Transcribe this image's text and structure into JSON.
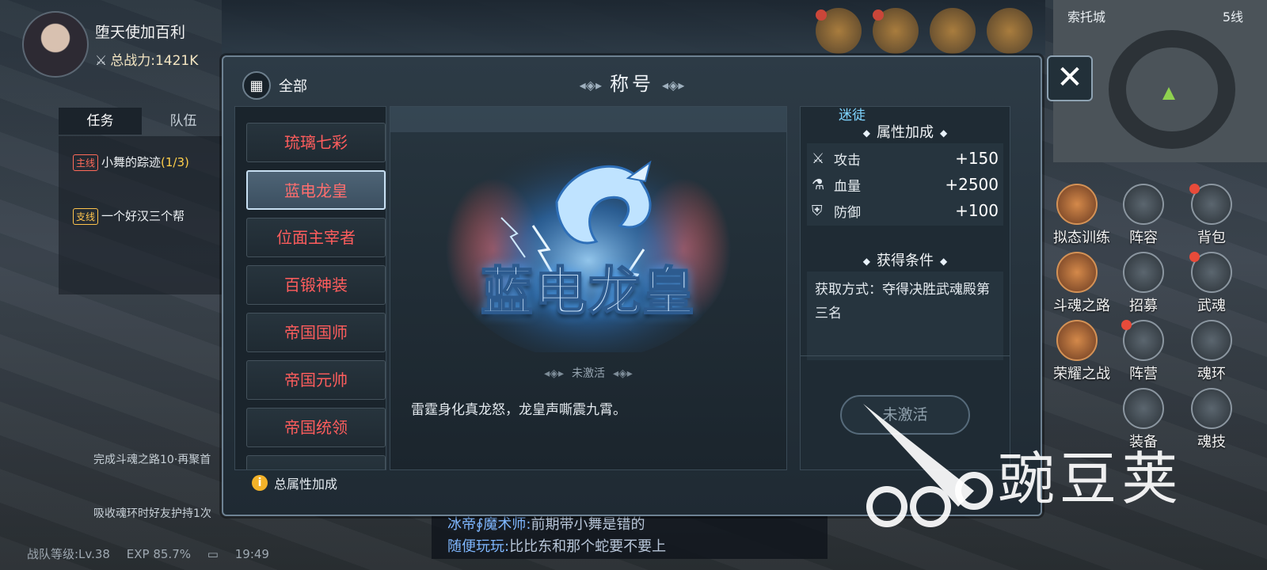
{
  "player": {
    "name": "堕天使加百利",
    "power": "总战力:1421K"
  },
  "left_tabs": [
    "任务",
    "队伍"
  ],
  "quests": [
    {
      "tag": "主线",
      "title": "小舞的踪迹",
      "progress": "(1/3)",
      "desc": "完成斗魂之路10·再聚首"
    },
    {
      "tag": "支线",
      "title": "一个好汉三个帮",
      "progress": "",
      "desc": "吸收魂环时好友护持1次"
    }
  ],
  "minimap": {
    "city": "索托城",
    "line": "5线"
  },
  "right_icons": [
    {
      "label": "拟态训练",
      "dot": false
    },
    {
      "label": "阵容",
      "dot": false
    },
    {
      "label": "背包",
      "dot": true
    },
    {
      "label": "斗魂之路",
      "dot": false
    },
    {
      "label": "招募",
      "dot": false
    },
    {
      "label": "武魂",
      "dot": true
    },
    {
      "label": "荣耀之战",
      "dot": false
    },
    {
      "label": "阵营",
      "dot": true
    },
    {
      "label": "魂环",
      "dot": false
    },
    {
      "label": "装备",
      "dot": false
    },
    {
      "label": "魂技",
      "dot": false
    }
  ],
  "chat": [
    {
      "who": "冰帝∮魔术师:",
      "msg": "前期带小舞是错的"
    },
    {
      "who": "随便玩玩:",
      "msg": "比比东和那个蛇要不要上"
    }
  ],
  "status": {
    "level": "战队等级:Lv.38",
    "exp": "EXP 85.7%",
    "time": "19:49"
  },
  "modal": {
    "title": "称号",
    "filter_label": "全部",
    "titles": [
      "琉璃七彩",
      "蓝电龙皇",
      "位面主宰者",
      "百锻神装",
      "帝国国师",
      "帝国元帅",
      "帝国统领"
    ],
    "selected_index": 1,
    "art_text": "蓝电龙皇",
    "state": "未激活",
    "description": "雷霆身化真龙怒，龙皇声嘶震九霄。",
    "tag": "迷徒",
    "attr_title": "属性加成",
    "attributes": [
      {
        "icon": "sword-icon",
        "name": "攻击",
        "value": "+150"
      },
      {
        "icon": "potion-icon",
        "name": "血量",
        "value": "+2500"
      },
      {
        "icon": "shield-icon",
        "name": "防御",
        "value": "+100"
      }
    ],
    "cond_title": "获得条件",
    "condition": "获取方式：夺得决胜武魂殿第三名",
    "activate_button": "未激活",
    "footer": "总属性加成"
  },
  "watermark": "豌豆荚"
}
